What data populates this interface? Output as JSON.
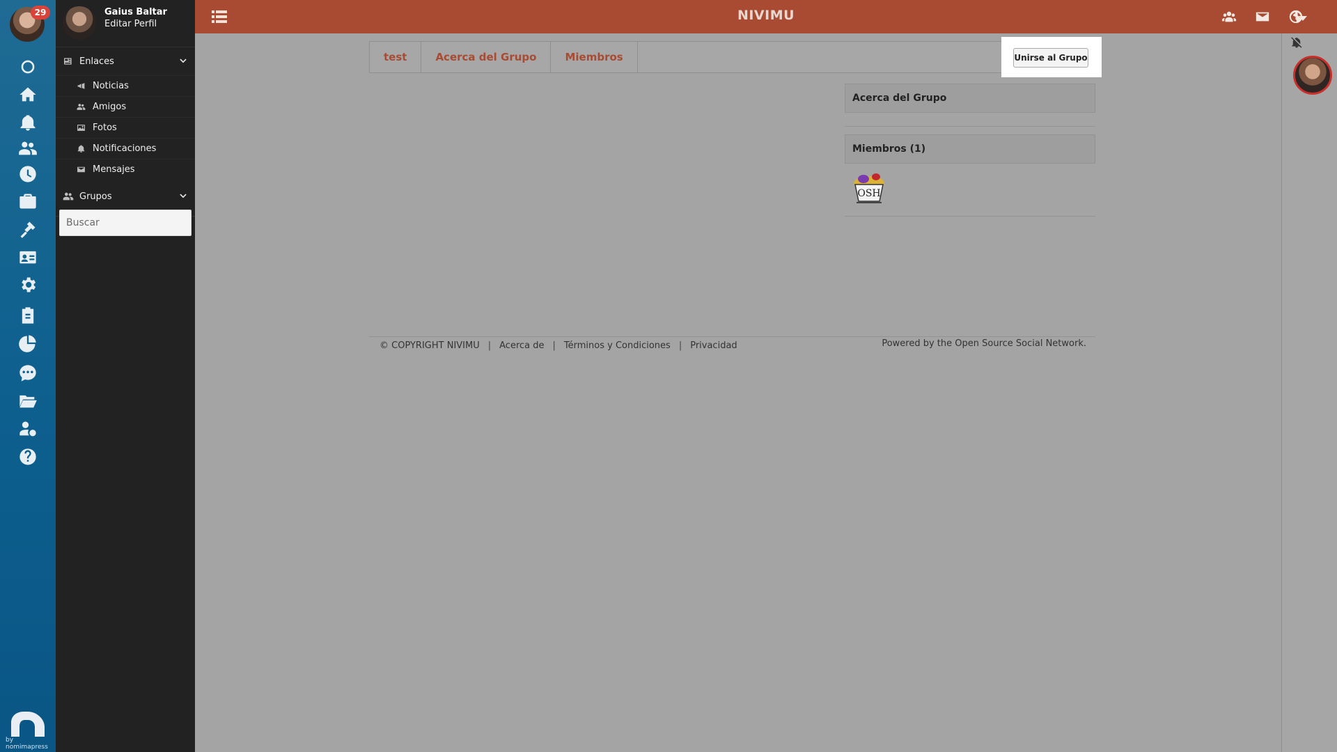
{
  "rail": {
    "badge": "29",
    "icons": [
      "circle-icon",
      "home-icon",
      "bell-icon",
      "users-icon",
      "clock-icon",
      "briefcase-icon",
      "tools-icon",
      "contact-card-icon",
      "gear-icon",
      "clipboard-icon",
      "pie-chart-icon",
      "chat-icon",
      "folder-open-icon",
      "user-dollar-icon",
      "help-icon"
    ],
    "logo_text": "by nomimapress"
  },
  "sidebar": {
    "user_name": "Gaius Baltar",
    "edit_profile": "Editar Perfil",
    "links_section": "Enlaces",
    "links": [
      {
        "label": "Noticias",
        "icon": "bullhorn-icon"
      },
      {
        "label": "Amigos",
        "icon": "users-icon"
      },
      {
        "label": "Fotos",
        "icon": "image-icon"
      },
      {
        "label": "Notificaciones",
        "icon": "bell-icon"
      },
      {
        "label": "Mensajes",
        "icon": "envelope-icon"
      }
    ],
    "groups_section": "Grupos",
    "search_placeholder": "Buscar"
  },
  "topbar": {
    "brand": "NIVIMU",
    "icons": [
      "users-icon",
      "envelope-icon",
      "globe-icon",
      "caret-down-icon"
    ]
  },
  "tabs": [
    {
      "label": "test"
    },
    {
      "label": "Acerca del Grupo"
    },
    {
      "label": "Miembros"
    }
  ],
  "join_button": "Unirse al Grupo",
  "widgets": {
    "about_title": "Acerca del Grupo",
    "members_title": "Miembros (1)"
  },
  "footer": {
    "copyright": "© COPYRIGHT NIVIMU",
    "about": "Acerca de",
    "terms": "Términos y Condiciones",
    "privacy": "Privacidad",
    "powered": "Powered by the Open Source Social Network."
  },
  "colors": {
    "topbar": "#a84b32",
    "rail": "#0d5f8e",
    "sidebar": "#222222",
    "badge": "#d8433a",
    "tab_text": "#a84b32"
  }
}
